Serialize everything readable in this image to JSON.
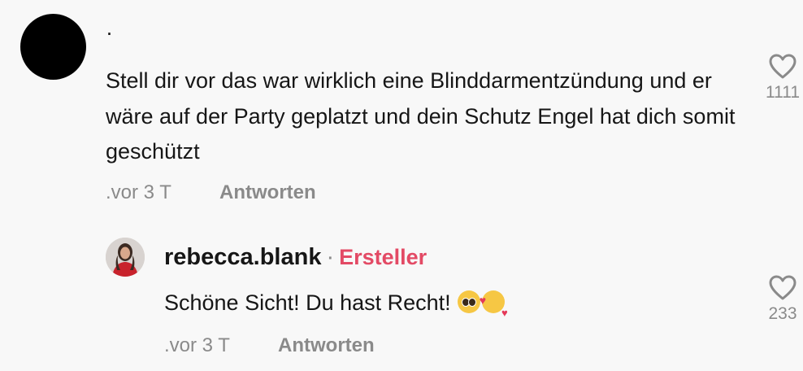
{
  "comment": {
    "username": "·",
    "text": "Stell dir vor das war wirklich eine Blinddarmentzündung und er wäre auf der Party geplatzt und dein Schutz Engel hat dich somit geschützt",
    "time": ".vor 3 T",
    "reply_label": "Antworten",
    "likes": "1111"
  },
  "reply": {
    "username": "rebecca.blank",
    "separator": "·",
    "badge": "Ersteller",
    "text": "Schöne Sicht! Du hast Recht!",
    "emojis": [
      "pleading-face",
      "smiling-face-with-hearts"
    ],
    "time": ".vor 3 T",
    "reply_label": "Antworten",
    "likes": "233"
  },
  "colors": {
    "background": "#f8f8f8",
    "text": "#161616",
    "muted": "#8a8a8a",
    "creator_badge": "#e34a65"
  }
}
